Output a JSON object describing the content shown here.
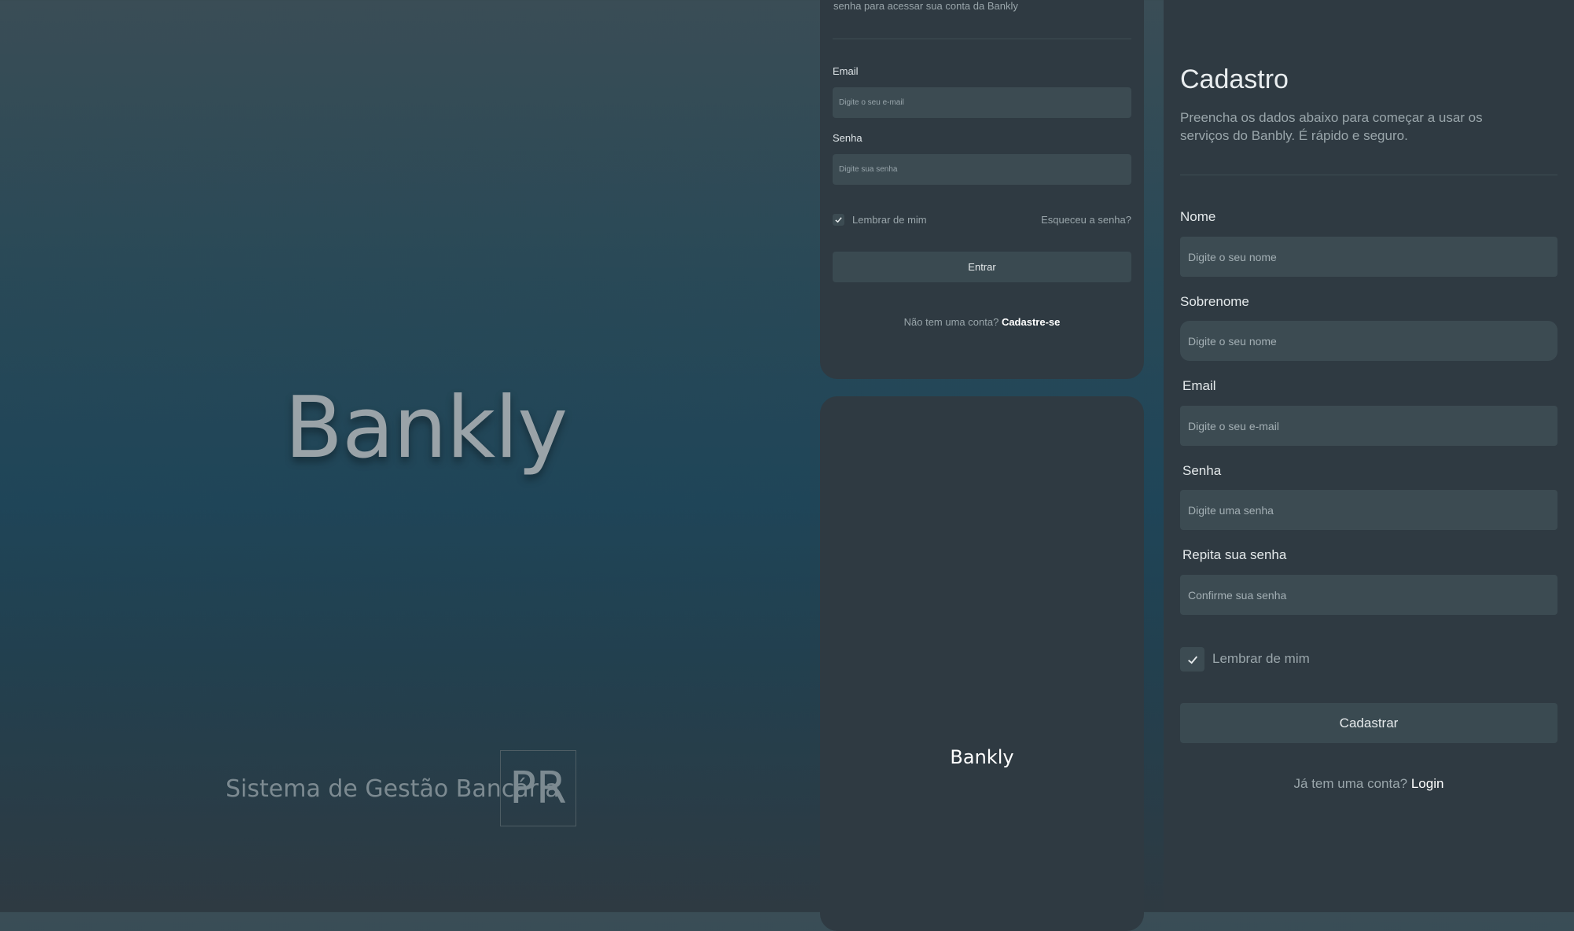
{
  "hero": {
    "title": "Bankly",
    "subtitle": "Sistema de Gestão Bancária",
    "badge": "PR"
  },
  "login": {
    "intro": "senha para acessar sua conta da Bankly",
    "email_label": "Email",
    "email_placeholder": "Digite o seu e-mail",
    "password_label": "Senha",
    "password_placeholder": "Digite sua senha",
    "remember_label": "Lembrar de mim",
    "forgot_link": "Esqueceu a senha?",
    "submit_label": "Entrar",
    "no_account_text": "Não tem uma conta?",
    "signup_link": "Cadastre-se"
  },
  "splash": {
    "logo": "Bankly"
  },
  "register": {
    "title": "Cadastro",
    "description": "Preencha os dados abaixo para começar a usar os serviços do Banbly. É rápido e seguro.",
    "fields": [
      {
        "label": "Nome",
        "placeholder": "Digite o seu nome"
      },
      {
        "label": "Sobrenome",
        "placeholder": "Digite o seu nome"
      },
      {
        "label": "Email",
        "placeholder": "Digite o seu e-mail"
      },
      {
        "label": "Senha",
        "placeholder": "Digite uma senha"
      },
      {
        "label": "Repita sua senha",
        "placeholder": "Confirme sua senha"
      }
    ],
    "remember_label": "Lembrar de mim",
    "submit_label": "Cadastrar",
    "have_account_text": "Já tem uma conta?",
    "login_link": "Login"
  },
  "icons": {
    "checkbox": "check-icon"
  }
}
